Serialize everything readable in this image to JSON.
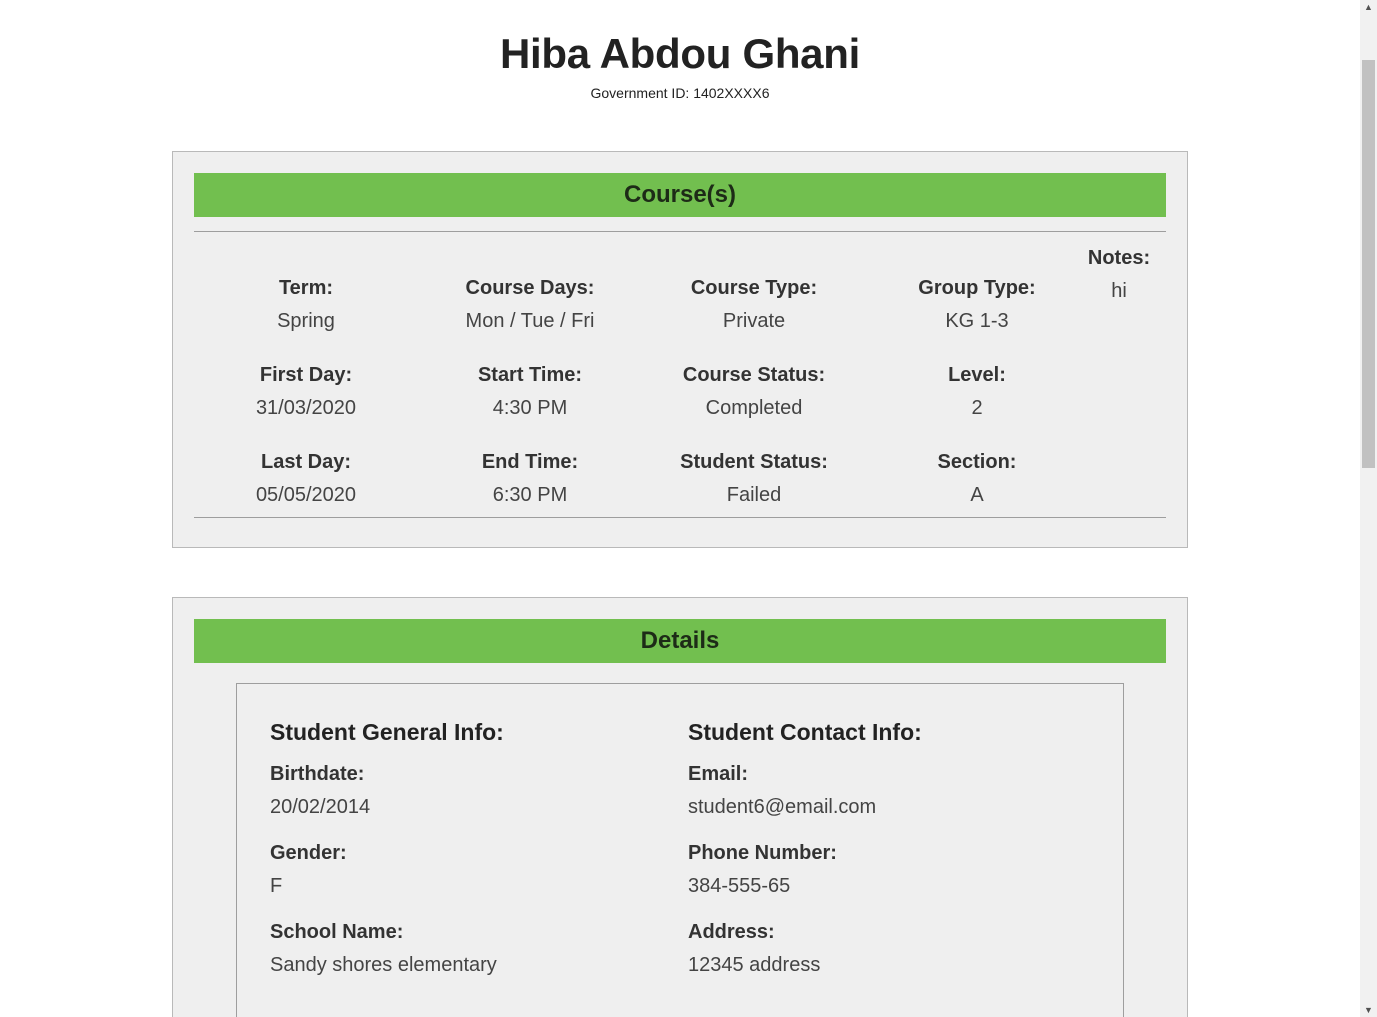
{
  "student": {
    "name": "Hiba Abdou Ghani",
    "government_id": "Government ID: 1402XXXX6"
  },
  "courses": {
    "header": "Course(s)",
    "term": {
      "label": "Term:",
      "value": "Spring"
    },
    "course_days": {
      "label": "Course Days:",
      "value": "Mon / Tue / Fri"
    },
    "course_type": {
      "label": "Course Type:",
      "value": "Private"
    },
    "group_type": {
      "label": "Group Type:",
      "value": "KG 1-3"
    },
    "first_day": {
      "label": "First Day:",
      "value": "31/03/2020"
    },
    "start_time": {
      "label": "Start Time:",
      "value": "4:30 PM"
    },
    "course_status": {
      "label": "Course Status:",
      "value": "Completed"
    },
    "level": {
      "label": "Level:",
      "value": "2"
    },
    "last_day": {
      "label": "Last Day:",
      "value": "05/05/2020"
    },
    "end_time": {
      "label": "End Time:",
      "value": "6:30 PM"
    },
    "student_status": {
      "label": "Student Status:",
      "value": "Failed"
    },
    "section": {
      "label": "Section:",
      "value": "A"
    },
    "notes": {
      "label": "Notes:",
      "value": "hi"
    }
  },
  "details": {
    "header": "Details",
    "general": {
      "title": "Student General Info:",
      "birthdate": {
        "label": "Birthdate:",
        "value": "20/02/2014"
      },
      "gender": {
        "label": "Gender:",
        "value": "F"
      },
      "school_name": {
        "label": "School Name:",
        "value": "Sandy shores elementary"
      }
    },
    "contact": {
      "title": "Student Contact Info:",
      "email": {
        "label": "Email:",
        "value": "student6@email.com"
      },
      "phone": {
        "label": "Phone Number:",
        "value": "384-555-65"
      },
      "address": {
        "label": "Address:",
        "value": "12345 address"
      }
    }
  },
  "icons": {
    "scroll_up": "▲",
    "scroll_down": "▼"
  },
  "colors": {
    "header_green": "#72bf4f",
    "panel_bg": "#efefef"
  }
}
